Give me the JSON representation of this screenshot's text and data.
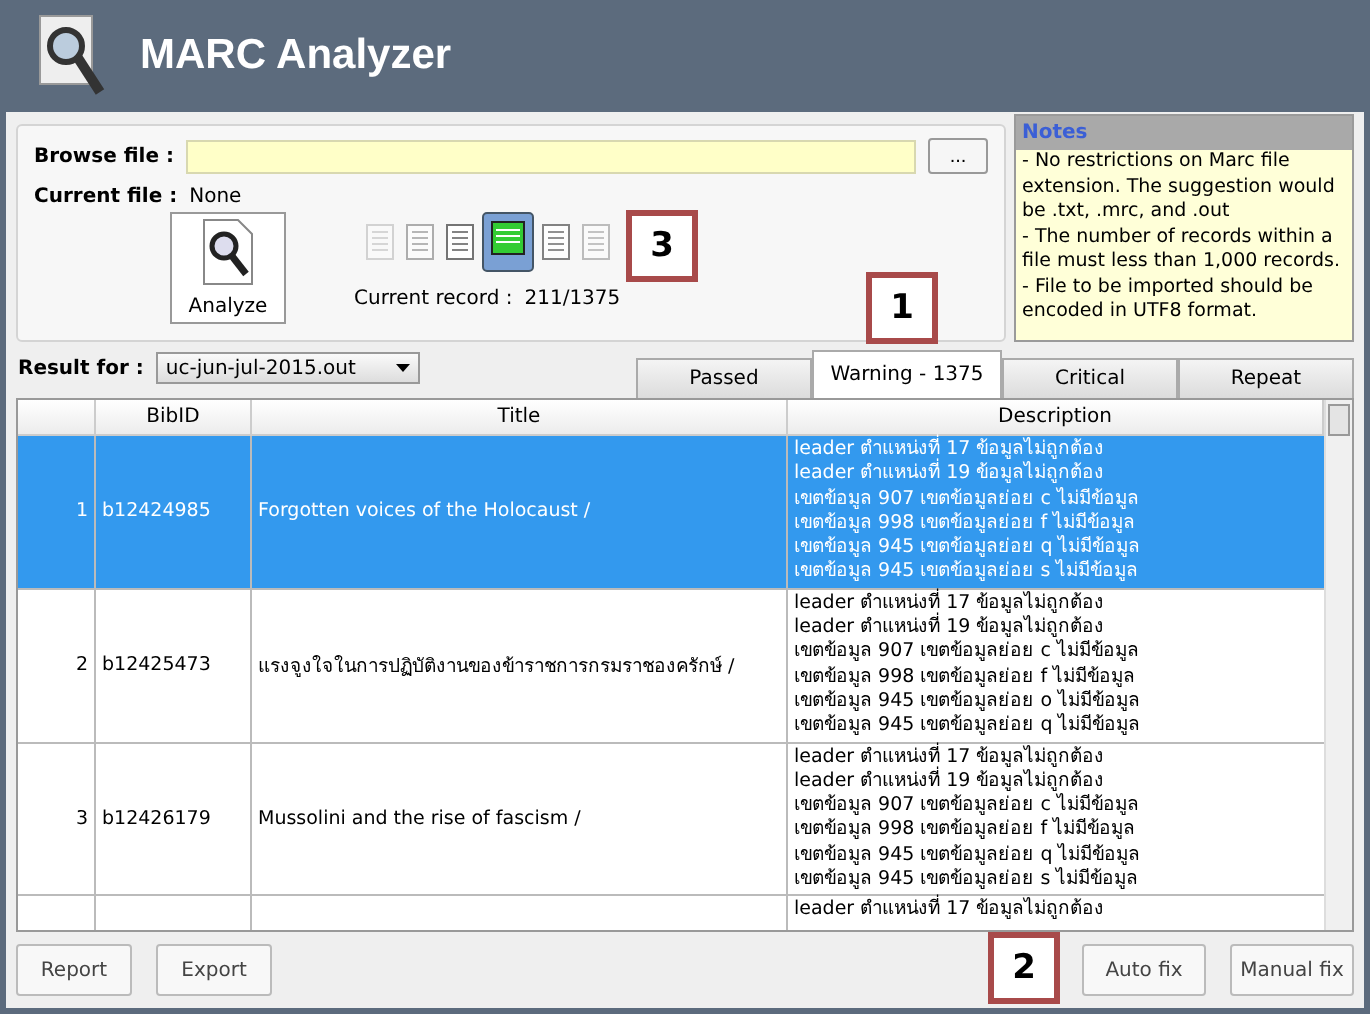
{
  "window": {
    "title": "MARC Analyzer"
  },
  "file": {
    "browse_label": "Browse file :",
    "browse_button": "...",
    "current_label": "Current file :",
    "current_value": "None"
  },
  "analyze_button": "Analyze",
  "record_strip": [
    {
      "selected": false
    },
    {
      "selected": false
    },
    {
      "selected": false
    },
    {
      "selected": true
    },
    {
      "selected": false
    },
    {
      "selected": false
    }
  ],
  "current_record": {
    "label": "Current record :",
    "value": "211/1375"
  },
  "notes": {
    "title": "Notes",
    "lines": [
      "- No restrictions on Marc file extension. The suggestion would be .txt, .mrc, and .out",
      "- The number of records within a file must less than 1,000 records.",
      "- File to be imported should be encoded in UTF8 format."
    ]
  },
  "result_for": {
    "label": "Result for :",
    "value": "uc-jun-jul-2015.out"
  },
  "tabs": [
    {
      "label": "Passed",
      "selected": false
    },
    {
      "label": "Warning - 1375",
      "selected": true
    },
    {
      "label": "Critical",
      "selected": false
    },
    {
      "label": "Repeat",
      "selected": false
    }
  ],
  "table": {
    "columns": [
      "BibID",
      "Title",
      "Description"
    ],
    "rows": [
      {
        "index": "1",
        "bibid": "b12424985",
        "title": "Forgotten voices of the Holocaust /",
        "selected": true,
        "description": [
          "leader ตำแหน่งที่ 17 ข้อมูลไม่ถูกต้อง",
          "leader ตำแหน่งที่ 19 ข้อมูลไม่ถูกต้อง",
          "เขตข้อมูล 907 เขตข้อมูลย่อย c ไม่มีข้อมูล",
          "เขตข้อมูล 998 เขตข้อมูลย่อย f ไม่มีข้อมูล",
          "เขตข้อมูล 945 เขตข้อมูลย่อย q ไม่มีข้อมูล",
          "เขตข้อมูล 945 เขตข้อมูลย่อย s ไม่มีข้อมูล"
        ]
      },
      {
        "index": "2",
        "bibid": "b12425473",
        "title": "แรงจูงใจในการปฏิบัติงานของข้าราชการกรมราชองครักษ์ /",
        "selected": false,
        "description": [
          "leader ตำแหน่งที่ 17 ข้อมูลไม่ถูกต้อง",
          "leader ตำแหน่งที่ 19 ข้อมูลไม่ถูกต้อง",
          "เขตข้อมูล 907 เขตข้อมูลย่อย c ไม่มีข้อมูล",
          "เขตข้อมูล 998 เขตข้อมูลย่อย f ไม่มีข้อมูล",
          "เขตข้อมูล 945 เขตข้อมูลย่อย o ไม่มีข้อมูล",
          "เขตข้อมูล 945 เขตข้อมูลย่อย q ไม่มีข้อมูล"
        ]
      },
      {
        "index": "3",
        "bibid": "b12426179",
        "title": "Mussolini and the rise of fascism /",
        "selected": false,
        "description": [
          "leader ตำแหน่งที่ 17 ข้อมูลไม่ถูกต้อง",
          "leader ตำแหน่งที่ 19 ข้อมูลไม่ถูกต้อง",
          "เขตข้อมูล 907 เขตข้อมูลย่อย c ไม่มีข้อมูล",
          "เขตข้อมูล 998 เขตข้อมูลย่อย f ไม่มีข้อมูล",
          "เขตข้อมูล 945 เขตข้อมูลย่อย q ไม่มีข้อมูล",
          "เขตข้อมูล 945 เขตข้อมูลย่อย s ไม่มีข้อมูล"
        ]
      },
      {
        "index": "",
        "bibid": "",
        "title": "",
        "selected": false,
        "description": [
          "leader ตำแหน่งที่ 17 ข้อมูลไม่ถูกต้อง"
        ]
      }
    ]
  },
  "buttons_left": [
    "Report",
    "Export"
  ],
  "buttons_right": [
    "Auto fix",
    "Manual fix"
  ],
  "callouts": [
    {
      "label": "3"
    },
    {
      "label": "1"
    },
    {
      "label": "2"
    }
  ]
}
